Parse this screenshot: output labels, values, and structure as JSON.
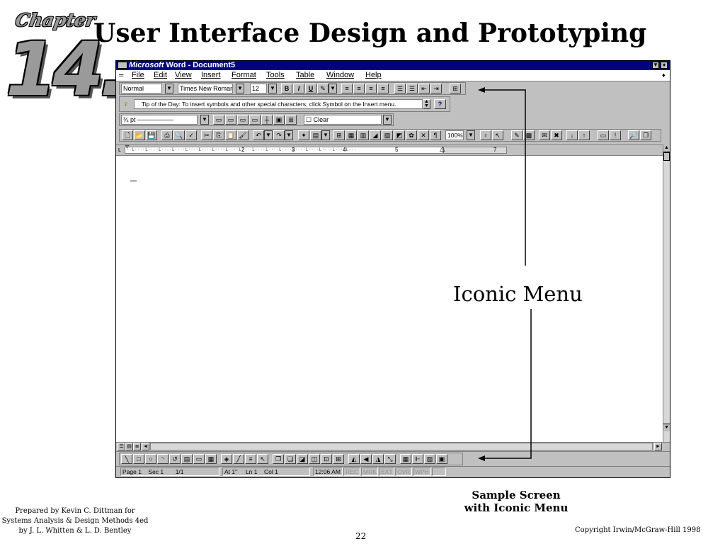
{
  "slide": {
    "chapter_word": "Chapter",
    "chapter_number": "14.",
    "title": "User Interface Design and Prototyping",
    "annotation_label": "Iconic Menu",
    "caption_line1": "Sample Screen",
    "caption_line2": "with Iconic Menu",
    "footer_left_line1": "Prepared by Kevin C. Dittman for",
    "footer_left_line2": "Systems Analysis & Design Methods 4ed",
    "footer_left_line3": "by J. L. Whitten & L. D. Bentley",
    "page_number": "22",
    "copyright": "Copyright Irwin/McGraw-Hill 1998"
  },
  "window": {
    "title_italic": "Microsoft",
    "title_rest": " Word - Document5",
    "menu": [
      "File",
      "Edit",
      "View",
      "Insert",
      "Format",
      "Tools",
      "Table",
      "Window",
      "Help"
    ]
  },
  "formatting_toolbar": {
    "style": "Normal",
    "font": "Times New Roman",
    "size": "12",
    "buttons": [
      "B",
      "I",
      "U"
    ]
  },
  "tip_of_day": {
    "text": "Tip of the Day: To insert symbols and other special characters, click Symbol on the Insert menu.",
    "help_button": "?"
  },
  "borders_toolbar": {
    "line_weight": "¾ pt",
    "shading": "Clear"
  },
  "standard_toolbar": {
    "zoom": "100%",
    "pilcrow": "¶"
  },
  "ruler": {
    "numbers": [
      "1",
      "2",
      "3",
      "4",
      "5",
      "6",
      "7"
    ]
  },
  "document": {
    "cursor": "_"
  },
  "status_bar": {
    "page": "Page 1",
    "section": "Sec 1",
    "pages": "1/1",
    "at": "At 1\"",
    "line": "Ln 1",
    "col": "Col 1",
    "time": "12:06 AM",
    "rec": "REC",
    "mrk": "MRK",
    "ext": "EXT",
    "ovr": "OVR",
    "wph": "WPH"
  }
}
